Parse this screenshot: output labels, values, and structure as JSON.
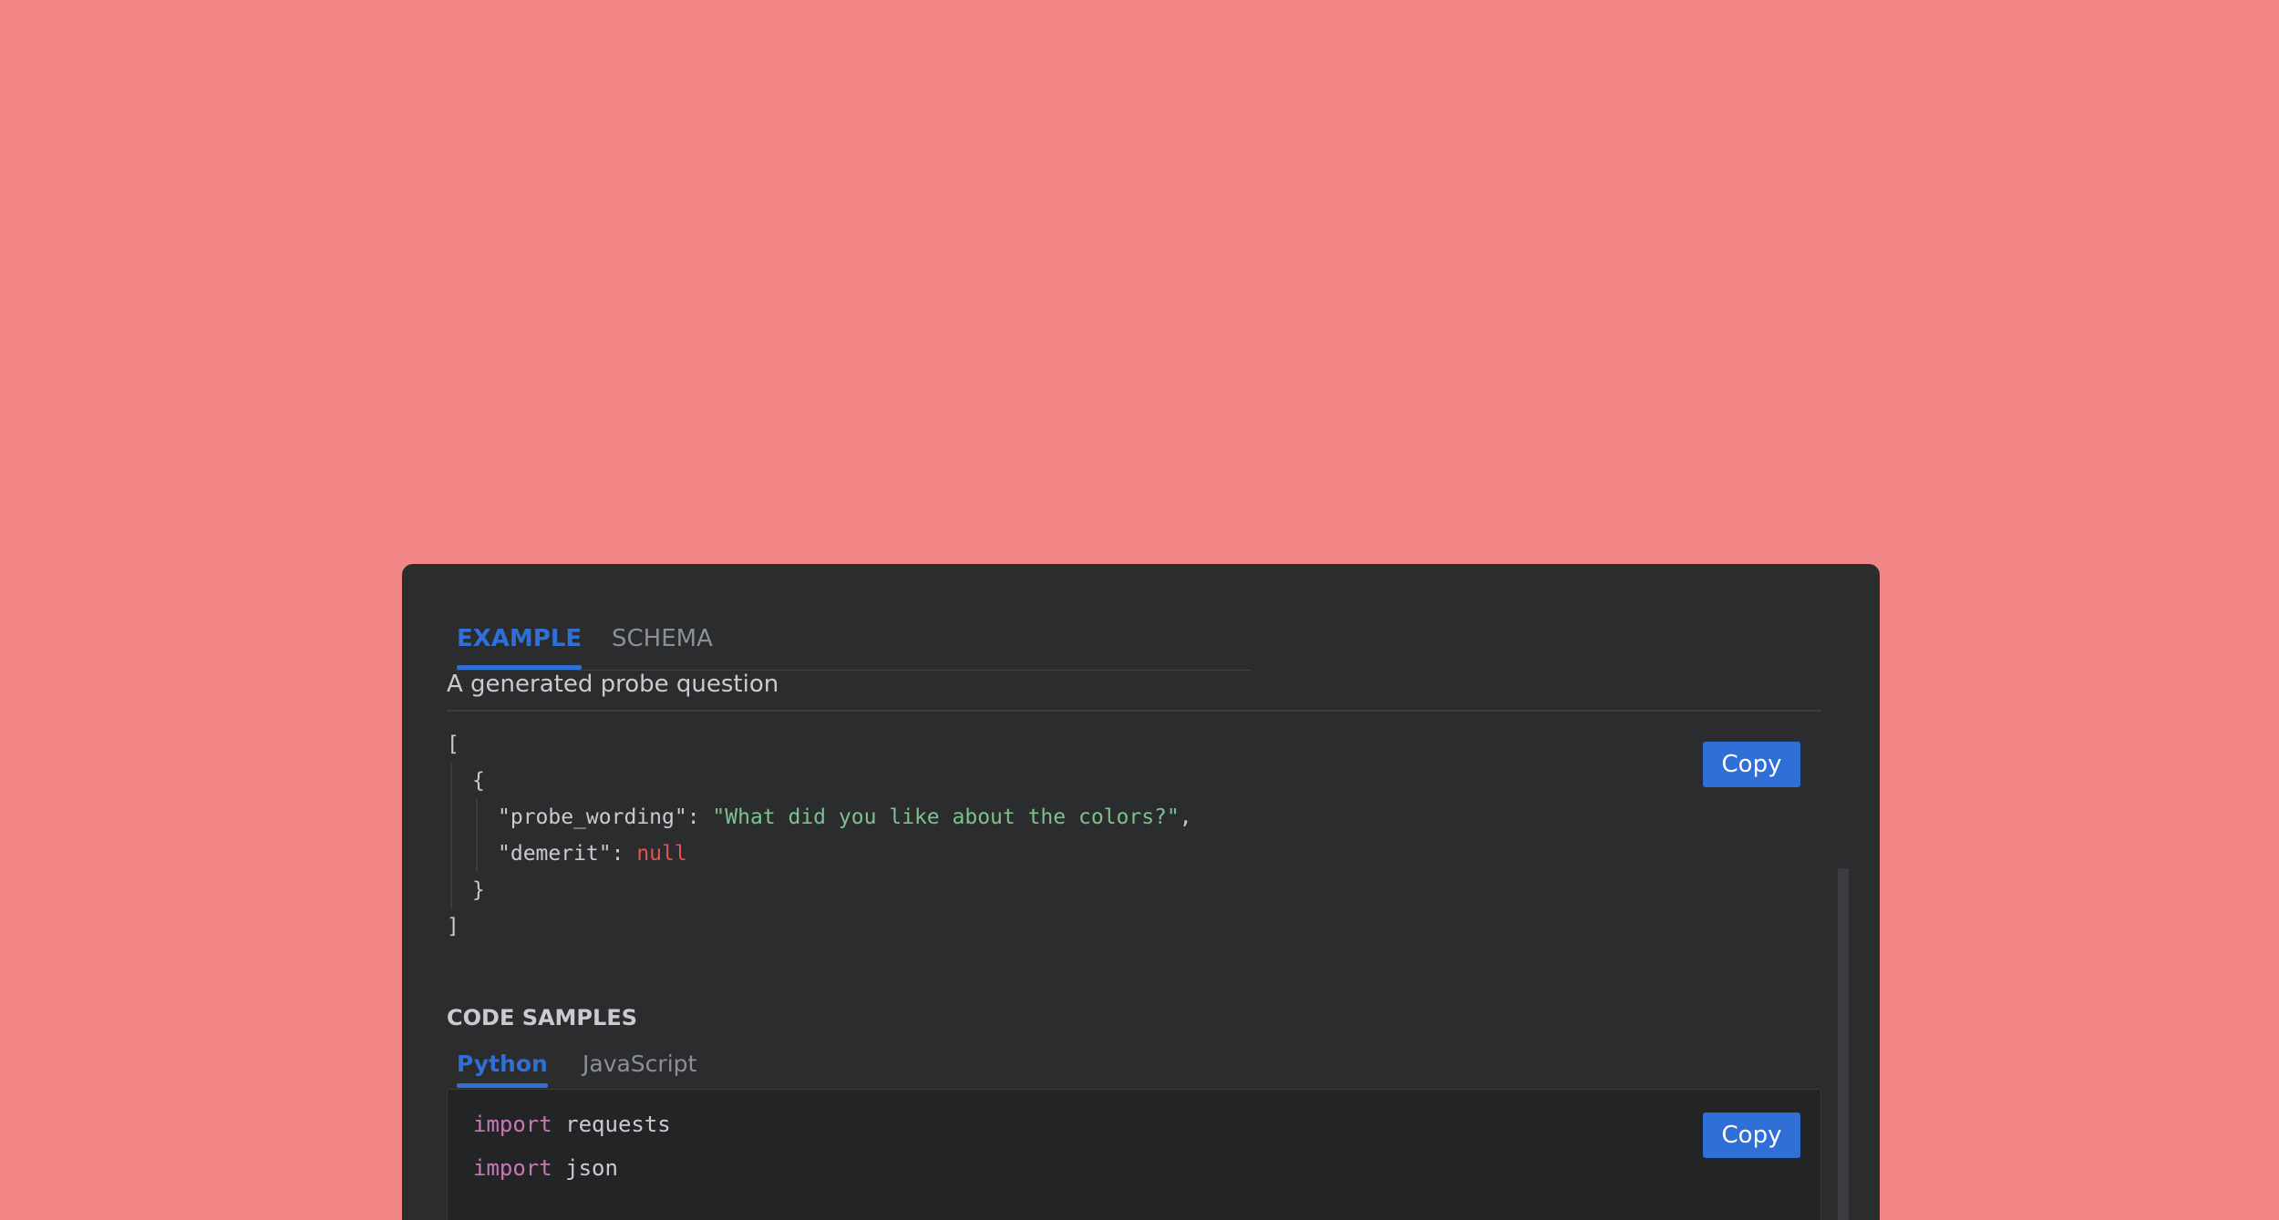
{
  "tabs": {
    "example": "EXAMPLE",
    "schema": "SCHEMA"
  },
  "response": {
    "description": "A generated probe question",
    "copy_label": "Copy",
    "json_lines": {
      "open_bracket": "[",
      "open_brace": "{",
      "probe_key": "\"probe_wording\": ",
      "probe_value": "\"What did you like about the colors?\"",
      "probe_comma": ",",
      "demerit_key": "\"demerit\": ",
      "demerit_value": "null",
      "close_brace": "}",
      "close_bracket": "]"
    }
  },
  "code_samples": {
    "title": "CODE SAMPLES",
    "tabs": {
      "python": "Python",
      "javascript": "JavaScript"
    },
    "copy_label": "Copy",
    "lines": [
      {
        "keyword": "import",
        "rest": " requests"
      },
      {
        "keyword": "import",
        "rest": " json"
      }
    ]
  },
  "colors": {
    "background": "#F28585",
    "panel": "#2B2C2E",
    "accent": "#2F6FD6",
    "string": "#7EC08E",
    "null": "#E0554F",
    "keyword": "#C678B6"
  }
}
